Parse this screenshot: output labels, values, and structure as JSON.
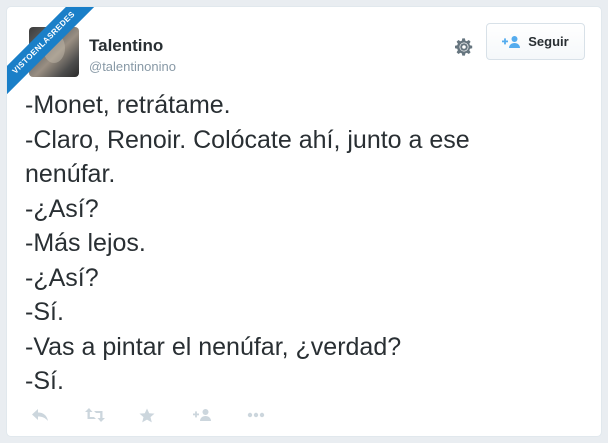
{
  "ribbon": {
    "text": "VISTOENLASREDES"
  },
  "user": {
    "name": "Talentino",
    "handle": "@talentinonino"
  },
  "follow_button": {
    "label": "Seguir"
  },
  "tweet": {
    "lines": [
      "-Monet, retrátame.",
      "-Claro, Renoir. Colócate ahí, junto a ese",
      "nenúfar.",
      "-¿Así?",
      "-Más lejos.",
      "-¿Así?",
      "-Sí.",
      "-Vas a pintar el nenúfar, ¿verdad?",
      "-Sí."
    ]
  },
  "actions": [
    {
      "name": "reply-icon"
    },
    {
      "name": "retweet-icon"
    },
    {
      "name": "favorite-icon"
    },
    {
      "name": "follow-user-icon"
    },
    {
      "name": "more-icon"
    }
  ],
  "colors": {
    "text": "#292f33",
    "muted": "#8899a6",
    "ribbon": "#1a7fc8",
    "follow_icon": "#55acee",
    "action_icon": "#ccd6dd"
  }
}
